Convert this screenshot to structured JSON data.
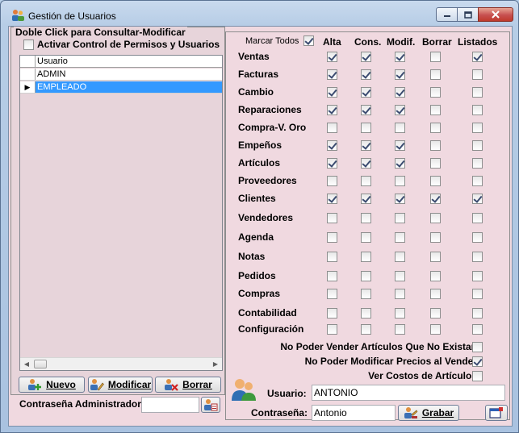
{
  "window": {
    "title": "Gestión de Usuarios",
    "minimize_icon": "minimize-icon",
    "maximize_icon": "maximize-icon",
    "close_icon": "close-icon"
  },
  "left": {
    "group_label": "Doble Click para Consultar-Modificar",
    "permission_control_label": "Activar Control de Permisos y Usuarios",
    "permission_control_checked": false,
    "grid": {
      "column": "Usuario",
      "rows": [
        {
          "name": "ADMIN",
          "selected": false
        },
        {
          "name": "EMPLEADO",
          "selected": true
        }
      ]
    },
    "buttons": {
      "nuevo": "Nuevo",
      "modificar": "Modificar",
      "borrar": "Borrar"
    },
    "admin_password_label": "Contraseña Administrador:",
    "admin_password_value": ""
  },
  "right": {
    "marcar_todos_label": "Marcar Todos",
    "marcar_todos_checked": true,
    "columns": [
      "Alta",
      "Cons.",
      "Modif.",
      "Borrar",
      "Listados"
    ],
    "rows": [
      {
        "label": "Ventas",
        "checks": [
          true,
          true,
          true,
          false,
          true
        ]
      },
      {
        "label": "Facturas",
        "checks": [
          true,
          true,
          true,
          false,
          false
        ]
      },
      {
        "label": "Cambio",
        "checks": [
          true,
          true,
          true,
          false,
          false
        ]
      },
      {
        "label": "Reparaciones",
        "checks": [
          true,
          true,
          true,
          false,
          false
        ]
      },
      {
        "label": "Compra-V. Oro",
        "checks": [
          false,
          false,
          false,
          false,
          false
        ]
      },
      {
        "label": "Empeños",
        "checks": [
          true,
          true,
          true,
          false,
          false
        ]
      },
      {
        "label": "Artículos",
        "checks": [
          true,
          true,
          true,
          false,
          false
        ]
      },
      {
        "label": "Proveedores",
        "checks": [
          false,
          false,
          false,
          false,
          false
        ]
      },
      {
        "label": "Clientes",
        "checks": [
          true,
          true,
          true,
          true,
          true
        ]
      },
      {
        "label": "Vendedores",
        "checks": [
          false,
          false,
          false,
          false,
          false
        ]
      },
      {
        "label": "Agenda",
        "checks": [
          false,
          false,
          false,
          false,
          false
        ]
      },
      {
        "label": "Notas",
        "checks": [
          false,
          false,
          false,
          false,
          false
        ]
      },
      {
        "label": "Pedidos",
        "checks": [
          false,
          false,
          false,
          false,
          false
        ]
      },
      {
        "label": "Compras",
        "checks": [
          false,
          false,
          false,
          false,
          false
        ]
      },
      {
        "label": "Contabilidad",
        "checks": [
          false,
          false,
          false,
          false,
          false
        ]
      },
      {
        "label": "Configuración",
        "checks": [
          false,
          false,
          false,
          false,
          false
        ]
      }
    ],
    "options": [
      {
        "label": "No Poder Vender Artículos Que No Existan",
        "checked": false
      },
      {
        "label": "No Poder Modificar Precios al Vender",
        "checked": true
      },
      {
        "label": "Ver Costos de Artículos",
        "checked": false
      }
    ],
    "usuario_label": "Usuario:",
    "usuario_value": "ANTONIO",
    "contrasena_label": "Contraseña:",
    "contrasena_value": "Antonio",
    "grabar_label": "Grabar"
  }
}
